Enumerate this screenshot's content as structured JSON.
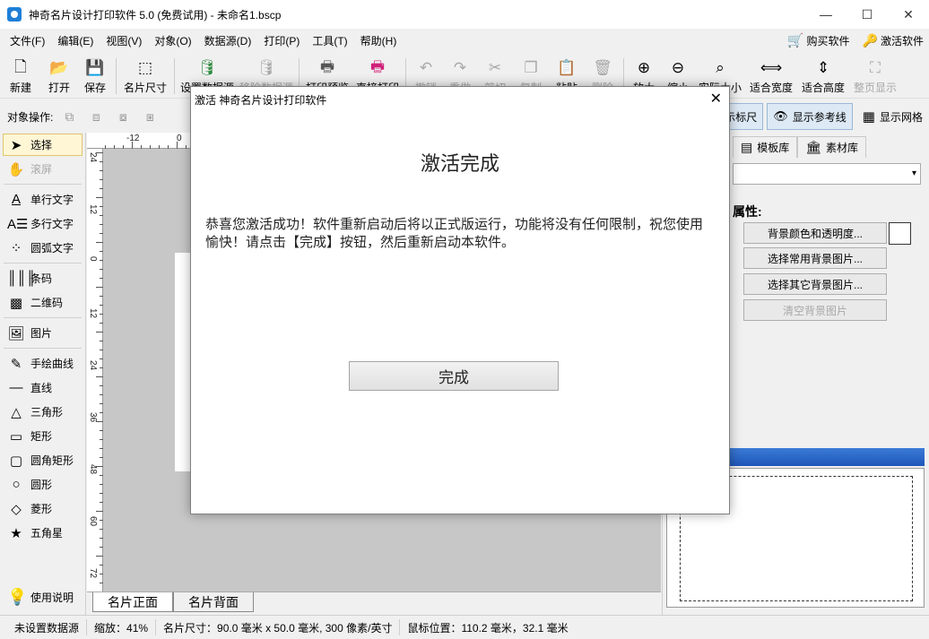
{
  "window": {
    "title": "神奇名片设计打印软件 5.0 (免费试用) - 未命名1.bscp",
    "controls": [
      "—",
      "☐",
      "✕"
    ]
  },
  "menu": {
    "items": [
      "文件(F)",
      "编辑(E)",
      "视图(V)",
      "对象(O)",
      "数据源(D)",
      "打印(P)",
      "工具(T)",
      "帮助(H)"
    ],
    "buy": "购买软件",
    "activate": "激活软件"
  },
  "toolbar": {
    "new": "新建",
    "open": "打开",
    "save": "保存",
    "card_size": "名片尺寸",
    "set_datasource": "设置数据源",
    "remove_datasource": "移除数据源",
    "print_preview": "打印预览",
    "direct_print": "直接打印",
    "undo": "撤销",
    "redo": "重做",
    "cut": "剪切",
    "copy": "复制",
    "paste": "粘贴",
    "delete": "删除",
    "zoom_in": "放大",
    "zoom_out": "缩小",
    "actual_size": "实际大小",
    "fit_width": "适合宽度",
    "fit_height": "适合高度",
    "full_page": "整页显示"
  },
  "opsbar": {
    "label": "对象操作:",
    "show_ruler": "示标尺",
    "show_guides": "显示参考线",
    "show_grid": "显示网格"
  },
  "leftpanel": {
    "select": "选择",
    "scroll": "滚屏",
    "single_text": "单行文字",
    "multi_text": "多行文字",
    "arc_text": "圆弧文字",
    "barcode": "条码",
    "qrcode": "二维码",
    "image": "图片",
    "freehand": "手绘曲线",
    "line": "直线",
    "triangle": "三角形",
    "rect": "矩形",
    "round_rect": "圆角矩形",
    "circle": "圆形",
    "diamond": "菱形",
    "star": "五角星",
    "help": "使用说明"
  },
  "rulers": {
    "top": [
      "-12",
      "0"
    ],
    "left": [
      "24",
      "12",
      "0",
      "12",
      "24",
      "36",
      "48",
      "60",
      "72"
    ]
  },
  "tabs": {
    "front": "名片正面",
    "back": "名片背面"
  },
  "rightpanel": {
    "template_tab": "模板库",
    "material_tab": "素材库",
    "heading": "属性:",
    "bg_color": "背景颜色和透明度...",
    "common_bg": "选择常用背景图片...",
    "other_bg": "选择其它背景图片...",
    "clear_bg": "清空背景图片"
  },
  "status": {
    "datasource": "未设置数据源",
    "zoom": "缩放：41%",
    "card_size": "名片尺寸：90.0 毫米 x 50.0 毫米, 300 像素/英寸",
    "mouse": "鼠标位置：110.2 毫米，32.1 毫米"
  },
  "dialog": {
    "title": "激活 神奇名片设计打印软件",
    "heading": "激活完成",
    "body": "恭喜您激活成功！软件重新启动后将以正式版运行，功能将没有任何限制，祝您使用愉快！请点击【完成】按钮，然后重新启动本软件。",
    "button": "完成",
    "close": "✕"
  },
  "colors": {
    "accent_blue": "#1e56b8",
    "active_chip": "#dde9f5",
    "selected_tool": "#fff6d6"
  }
}
